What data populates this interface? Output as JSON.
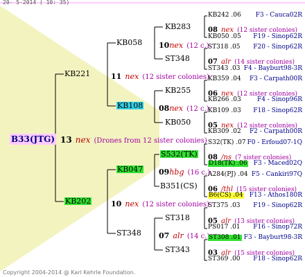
{
  "header": "20- 5-2014 ( 10: 35)",
  "footer": "Copyright 2004-2014 @ Karl Kehrle Foundation.",
  "colors": {
    "nex": "#c00000",
    "desc": "#a000a0",
    "source": "#00008b",
    "highlight_green": "#33e033",
    "highlight_cyan": "#33cfe6",
    "highlight_yellow": "#ffff33",
    "root_bg": "#ffccff",
    "watermark": "#f3f3c0"
  },
  "root": {
    "name": "B33(JTG)",
    "num": "13",
    "nex": "nex",
    "desc": "(Drones from 12 sister colonies)"
  },
  "level1": [
    {
      "name": "KB221",
      "num": "11",
      "nex": "nex",
      "desc": "(12 sister colonies)"
    },
    {
      "name": "KB202",
      "num": "10",
      "nex": "nex",
      "desc": "(12 sister colonies)"
    }
  ],
  "level2": [
    {
      "name": "KB058",
      "num": "10",
      "nex": "nex",
      "desc": "(12 c.)"
    },
    {
      "name": "KB108",
      "num": "08",
      "nex": "nex",
      "desc": "(12 c.)"
    },
    {
      "name": "KB047",
      "num": "09",
      "nex": "hbg",
      "desc": "(16 c.)"
    },
    {
      "name": "ST348",
      "num": "07",
      "nex": "alr",
      "desc": "(14 c.)"
    }
  ],
  "level3": [
    {
      "name": "KB283"
    },
    {
      "name": "ST348"
    },
    {
      "name": "KB255"
    },
    {
      "name": "KB050"
    },
    {
      "name": "S532(TK)"
    },
    {
      "name": "B351(CS)"
    },
    {
      "name": "ST318"
    },
    {
      "name": "ST343"
    }
  ],
  "leaves": [
    {
      "id": "KB242 .06",
      "src": "F3 - Cauca02R"
    },
    {
      "num": "08",
      "nex": "nex",
      "desc": "(12 sister colonies)"
    },
    {
      "id": "KB050 .05",
      "src": "F19 - Sinop62R"
    },
    {
      "id": "ST318 .05",
      "src": "F20 - Sinop62R"
    },
    {
      "num": "07",
      "nex": "alr",
      "desc": "(14 sister colonies)"
    },
    {
      "id": "ST343 .03",
      "src": "F4 - Bayburt98-3R"
    },
    {
      "id": "KB359 .04",
      "src": "F3 - Carpath00R"
    },
    {
      "num": "06",
      "nex": "nex",
      "desc": "(12 sister colonies)"
    },
    {
      "id": "KB266 .03",
      "src": "F4 - Sinop96R"
    },
    {
      "id": "KB109 .03",
      "src": "F18 - Sinop62R"
    },
    {
      "num": "05",
      "nex": "nex",
      "desc": "(12 sister colonies)"
    },
    {
      "id": "KB309 .02",
      "src": "F2 - Carpath00R"
    },
    {
      "id": "S32(TK) .07",
      "src": "F0 - Erfoud07-1Q"
    },
    {
      "num": "08",
      "nex": "/ns",
      "desc": "(7 sister colonies)"
    },
    {
      "id": "D18(TK) .06",
      "src": "F3 - Maced02Q"
    },
    {
      "id": "A284(PJ) .04",
      "src": "F5 - Cankiri97Q"
    },
    {
      "num": "06",
      "nex": "/thl",
      "desc": "(15 sister colonies)"
    },
    {
      "id": "B6(CS) .04",
      "src": "F13 - Athos180R"
    },
    {
      "id": "ST375 .03",
      "src": "F19 - Sinop62R"
    },
    {
      "num": "05",
      "nex": "alr",
      "desc": "(13 sister colonies)"
    },
    {
      "id": "PS017 .01",
      "src": "F16 - Sinop72R"
    },
    {
      "id": "ST308 .01",
      "src": "F3 - Bayburt98-3R"
    },
    {
      "num": "03",
      "nex": "alr",
      "desc": "(15 sister colonies)"
    },
    {
      "id": "ST369 .00",
      "src": "F18 - Sinop62R"
    }
  ]
}
